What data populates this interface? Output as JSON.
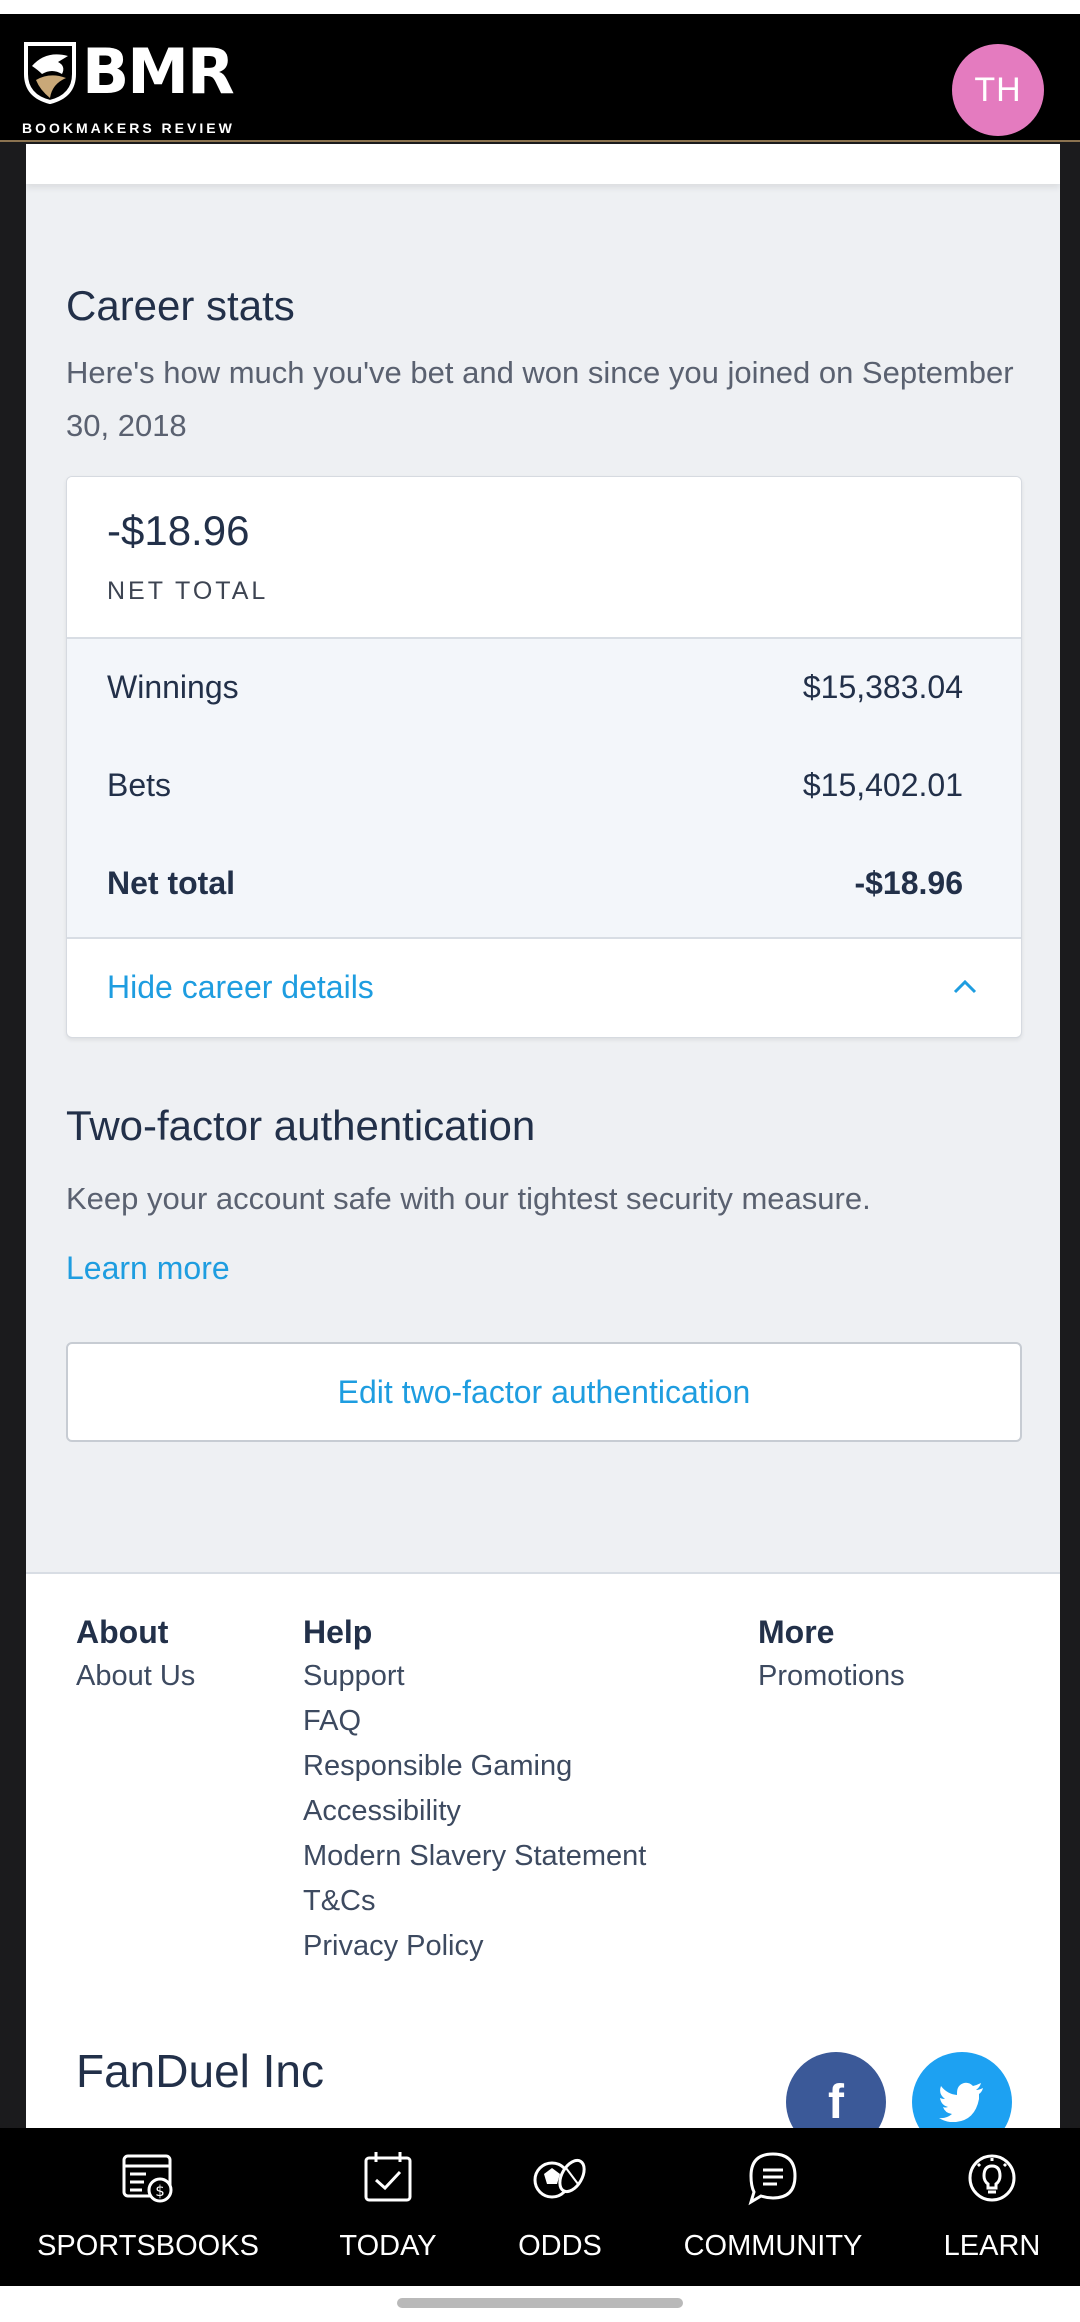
{
  "header": {
    "logo_text": "BMR",
    "logo_subtitle": "BOOKMAKERS REVIEW",
    "avatar_initials": "TH",
    "avatar_color": "#e47bbf",
    "accent_color": "#8b7350"
  },
  "career_stats": {
    "title": "Career stats",
    "description": "Here's how much you've bet and won since you joined on September 30, 2018",
    "net_total_value": "-$18.96",
    "net_total_caption": "NET TOTAL",
    "rows": [
      {
        "label": "Winnings",
        "value": "$15,383.04"
      },
      {
        "label": "Bets",
        "value": "$15,402.01"
      },
      {
        "label": "Net total",
        "value": "-$18.96"
      }
    ],
    "toggle_label": "Hide career details",
    "toggle_icon": "chevron-up-icon"
  },
  "two_factor": {
    "title": "Two-factor authentication",
    "description": "Keep your account safe with our tightest security measure.",
    "learn_more": "Learn more",
    "edit_button": "Edit two-factor authentication"
  },
  "footer": {
    "columns": [
      {
        "heading": "About",
        "links": [
          "About Us"
        ]
      },
      {
        "heading": "Help",
        "links": [
          "Support",
          "FAQ",
          "Responsible Gaming",
          "Accessibility",
          "Modern Slavery Statement",
          "T&Cs",
          "Privacy Policy"
        ]
      },
      {
        "heading": "More",
        "links": [
          "Promotions"
        ]
      }
    ],
    "company": "FanDuel Inc",
    "social": [
      "facebook-icon",
      "twitter-icon"
    ],
    "link_color": "#1e9de0"
  },
  "bottom_nav": {
    "items": [
      {
        "label": "SPORTSBOOKS",
        "icon": "sportsbook-icon"
      },
      {
        "label": "TODAY",
        "icon": "calendar-check-icon"
      },
      {
        "label": "ODDS",
        "icon": "balls-icon"
      },
      {
        "label": "COMMUNITY",
        "icon": "chat-icon"
      },
      {
        "label": "LEARN",
        "icon": "lightbulb-icon"
      }
    ]
  }
}
